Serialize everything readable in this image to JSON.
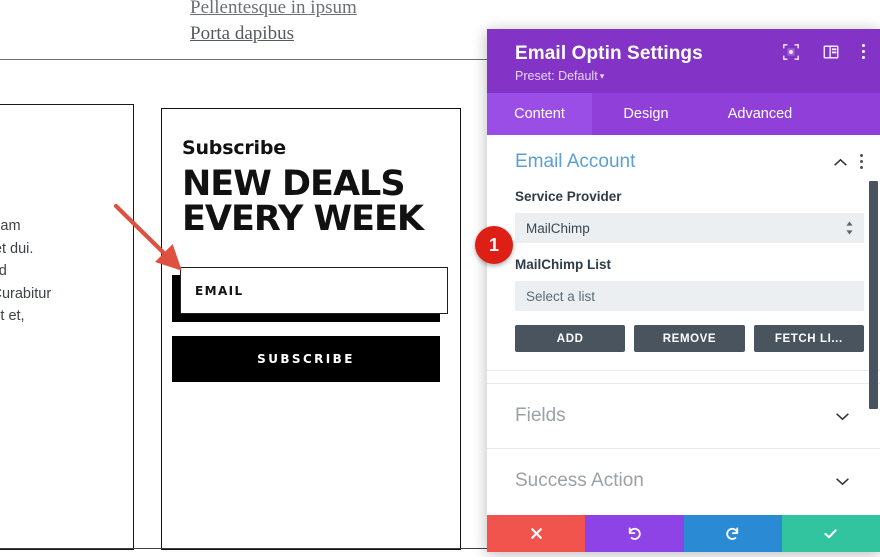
{
  "preview": {
    "top_links": [
      {
        "text": "Pellentesque in ipsum",
        "clipped": true
      },
      {
        "text": "Porta dapibus",
        "clipped": false
      }
    ],
    "body_copy": "amet quam\nl sit amet dui.\numsan id\nt sem. Curabitur\nmperdiet et,",
    "optin": {
      "eyebrow": "Subscribe",
      "headline": "NEW DEALS\nEVERY WEEK",
      "email_placeholder": "EMAIL",
      "email_value": "",
      "submit_label": "SUBSCRIBE"
    },
    "annotation": {
      "arrow_color": "#e0503f",
      "step_number": "1"
    }
  },
  "panel": {
    "title": "Email Optin Settings",
    "preset_label": "Preset: Default",
    "header_icons": [
      {
        "name": "focus-target-icon"
      },
      {
        "name": "layout-columns-icon"
      },
      {
        "name": "kebab-menu-icon"
      }
    ],
    "tabs": [
      {
        "label": "Content",
        "active": true
      },
      {
        "label": "Design",
        "active": false
      },
      {
        "label": "Advanced",
        "active": false
      }
    ],
    "sections": [
      {
        "title": "Email Account",
        "open": true,
        "fields": {
          "service_provider_label": "Service Provider",
          "service_provider_value": "MailChimp",
          "list_label": "MailChimp List",
          "list_placeholder": "Select a list",
          "buttons": [
            "ADD",
            "REMOVE",
            "FETCH LI..."
          ]
        }
      },
      {
        "title": "Fields",
        "open": false
      },
      {
        "title": "Success Action",
        "open": false
      }
    ],
    "footer_buttons": [
      {
        "name": "cancel",
        "icon": "close-icon",
        "color": "#f0544d"
      },
      {
        "name": "undo",
        "icon": "undo-icon",
        "color": "#8e43e6"
      },
      {
        "name": "redo",
        "icon": "redo-icon",
        "color": "#2a8ad4"
      },
      {
        "name": "save",
        "icon": "check-icon",
        "color": "#31c49f"
      }
    ],
    "colors": {
      "header_purple": "#8334c6",
      "tabbar_purple": "#9040d8",
      "tab_active_purple": "#9b4ee6",
      "section_open_title": "#5b9fd4",
      "section_closed_title": "#9aa2a8",
      "dark_button": "#49545f",
      "input_grey": "#eceff1",
      "scrollbar": "#47535e"
    }
  }
}
